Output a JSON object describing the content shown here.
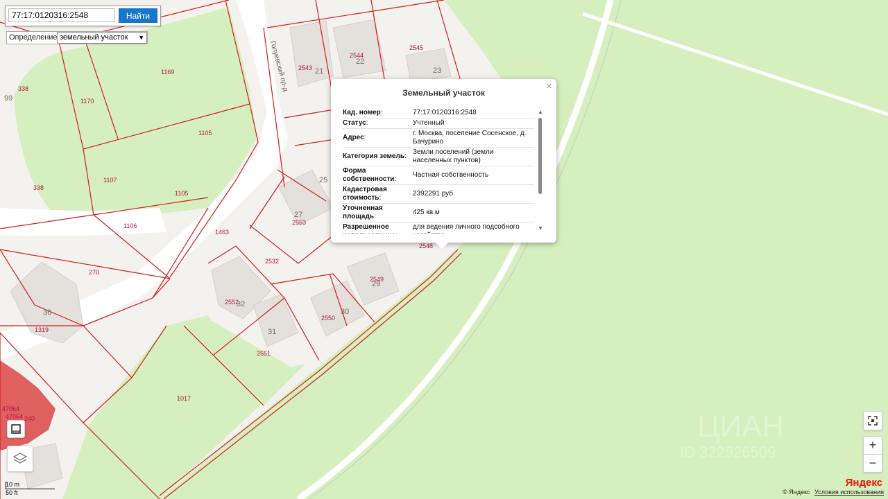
{
  "search": {
    "value": "77:17:0120316:2548",
    "button_label": "Найти"
  },
  "definition": {
    "label": "Определение:",
    "selected": "земельный участок"
  },
  "popup": {
    "title": "Земельный участок",
    "rows": [
      {
        "key": "Кад. номер",
        "value": "77:17:0120316:2548"
      },
      {
        "key": "Статус",
        "value": "Учтенный"
      },
      {
        "key": "Адрес",
        "value": "г. Москва, поселение Сосенское, д. Бачурино"
      },
      {
        "key": "Категория земель",
        "value": "Земли поселений (земли населенных пунктов)"
      },
      {
        "key": "Форма собственности",
        "value": "Частная собственность"
      },
      {
        "key": "Кадастровая стоимость",
        "value": "2392291 руб"
      },
      {
        "key": "Уточненная площадь",
        "value": "425 кв.м"
      },
      {
        "key": "Разрешенное использование",
        "value": "для ведения личного подсобного хозяйства"
      }
    ]
  },
  "map": {
    "street_name": "Голуевский пр-д",
    "parcel_labels": [
      "1169",
      "338",
      "99",
      "1170",
      "1105",
      "1107",
      "338",
      "1105",
      "1106",
      "1463",
      "270",
      "36",
      "1319",
      "47064",
      "47064",
      "240",
      "1017",
      "2543",
      "21",
      "2544",
      "22",
      "2545",
      "23",
      "2553",
      "27",
      "2532",
      "2552",
      "32",
      "31",
      "2551",
      "2550",
      "30",
      "2549",
      "29",
      "2548",
      "25"
    ],
    "colors": {
      "parcel_border": "#d31c1c",
      "green": "#d4efbd",
      "road": "#ffffff",
      "building": "#e4e1dc",
      "red_building": "#e05a5a"
    }
  },
  "controls": {
    "zoom_in": "+",
    "zoom_out": "−",
    "fullscreen_icon": "fullscreen-icon",
    "ruler_icon": "ruler-icon",
    "layers_icon": "layers-icon"
  },
  "scale": {
    "metric": "10 m",
    "imperial": "50 ft"
  },
  "footer": {
    "copyright": "© Яндекс",
    "terms": "Условия использования",
    "logo": "Яндекс"
  },
  "watermarks": {
    "cian": "ЦИАН",
    "cian_id": "ID 322926509"
  }
}
